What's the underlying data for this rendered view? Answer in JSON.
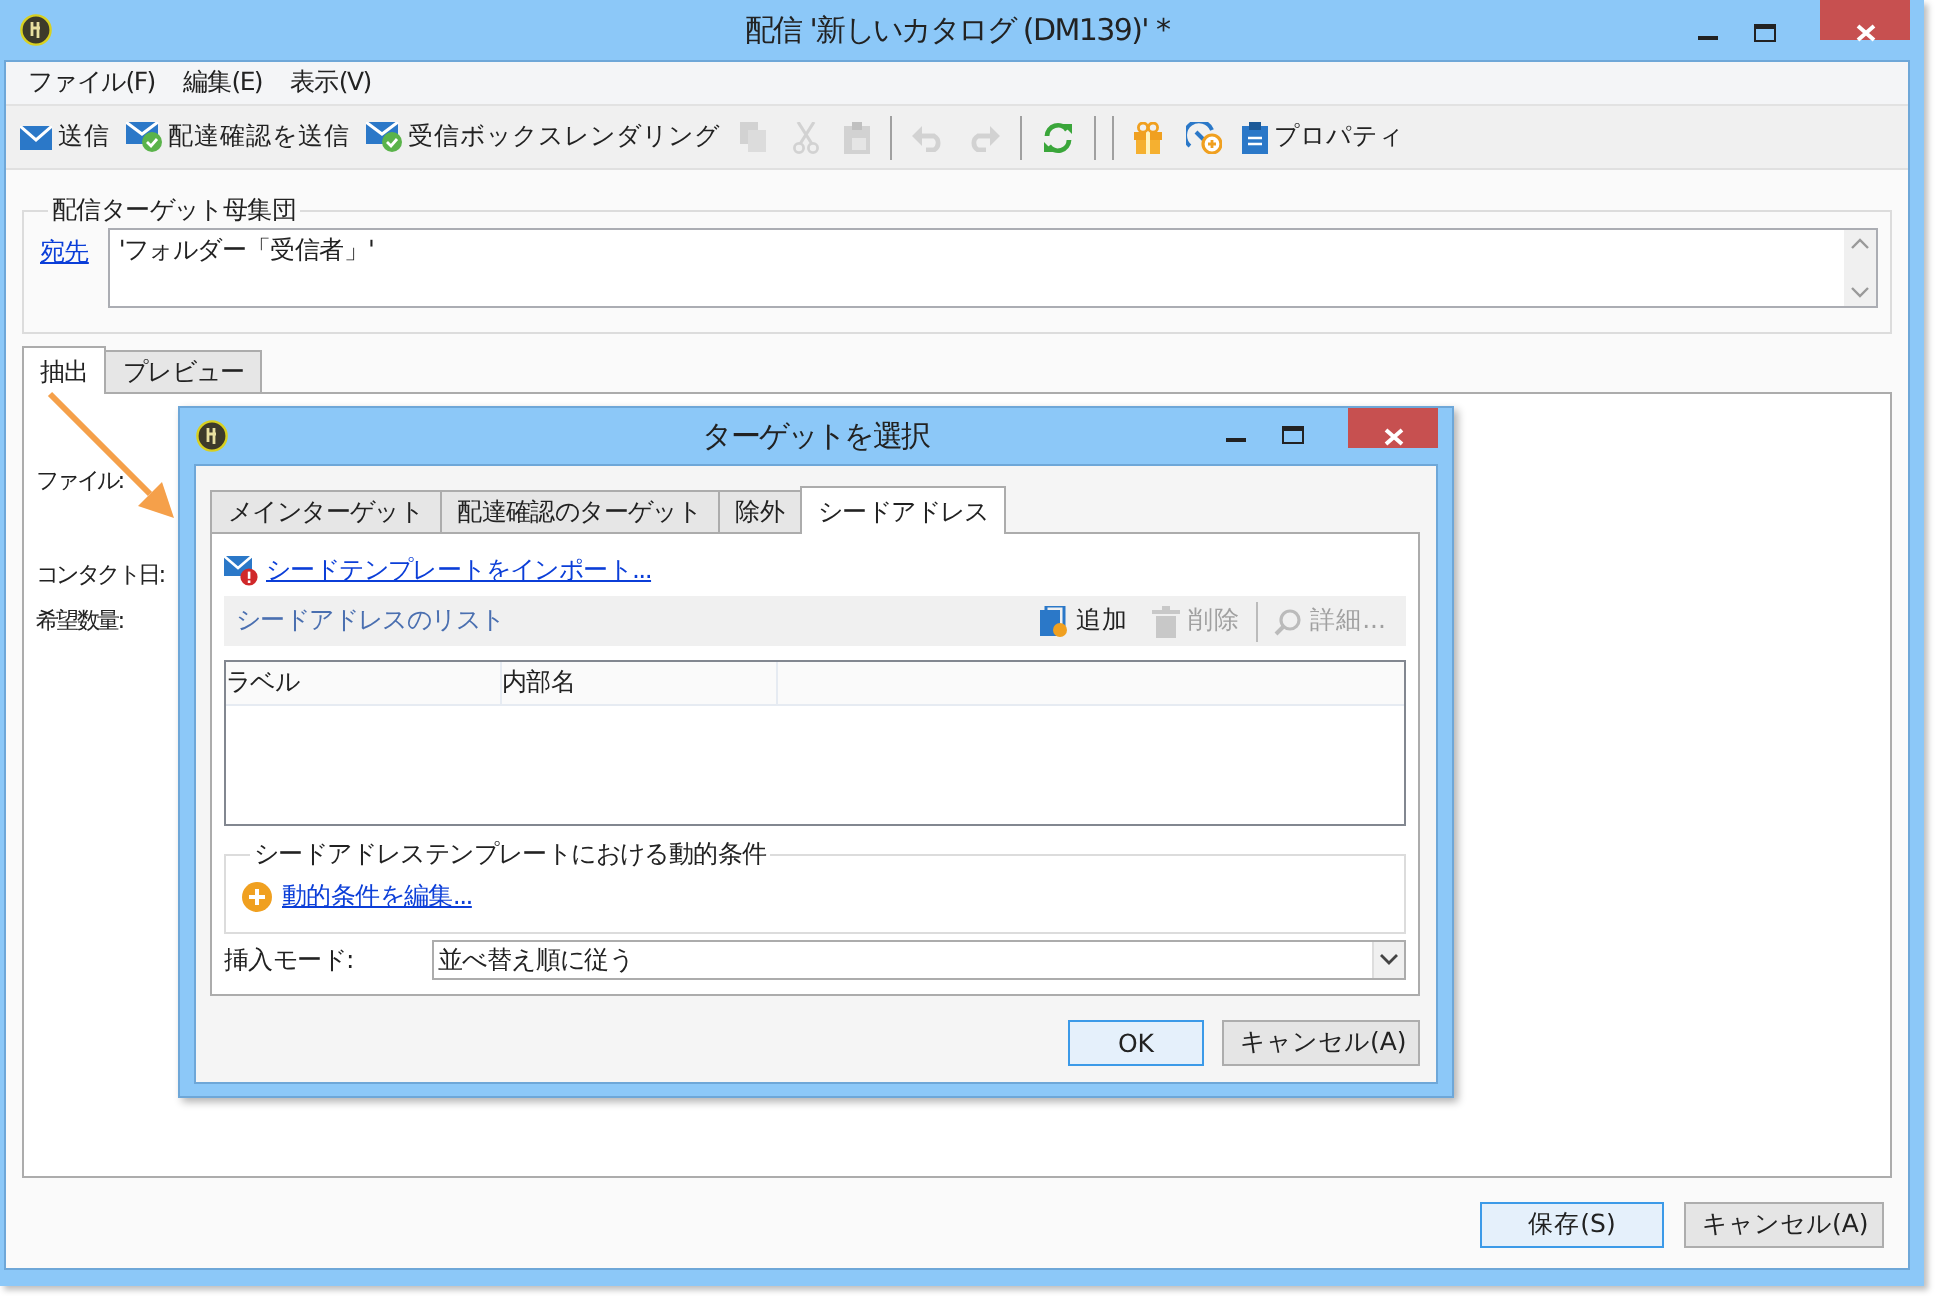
{
  "window": {
    "title": "配信 '新しいカタログ (DM139)' *"
  },
  "menu": [
    "ファイル(F)",
    "編集(E)",
    "表示(V)"
  ],
  "toolbar": [
    {
      "kind": "labeled",
      "label": "送信",
      "disabled": false
    },
    {
      "kind": "labeled",
      "label": "配達確認を送信",
      "disabled": false
    },
    {
      "kind": "labeled",
      "label": "受信ボックスレンダリング",
      "disabled": false
    },
    {
      "kind": "icon",
      "disabled": true
    },
    {
      "kind": "icon",
      "disabled": true
    },
    {
      "kind": "icon",
      "disabled": true
    },
    {
      "kind": "separator"
    },
    {
      "kind": "icon",
      "disabled": true
    },
    {
      "kind": "icon",
      "disabled": true
    },
    {
      "kind": "separator"
    },
    {
      "kind": "icon",
      "disabled": false
    },
    {
      "kind": "separator"
    },
    {
      "kind": "separator"
    },
    {
      "kind": "icon",
      "disabled": false
    },
    {
      "kind": "icon",
      "disabled": false
    },
    {
      "kind": "labeled",
      "label": "プロパティ",
      "disabled": false
    }
  ],
  "population": {
    "legend": "配信ターゲット母集団",
    "link": "宛先",
    "value": "'フォルダー「受信者」'"
  },
  "main_tabs": [
    {
      "label": "抽出",
      "selected": true
    },
    {
      "label": "プレビュー",
      "selected": false
    }
  ],
  "fields": [
    "ファイル:",
    "コンタクト日:",
    "希望数量:"
  ],
  "buttons": [
    {
      "label": "保存(S)",
      "default": true
    },
    {
      "label": "キャンセル(A)",
      "default": false
    }
  ],
  "dialog": {
    "title": "ターゲットを選択",
    "tabs": [
      {
        "label": "メインターゲット",
        "selected": false
      },
      {
        "label": "配達確認のターゲット",
        "selected": false
      },
      {
        "label": "除外",
        "selected": false
      },
      {
        "label": "シードアドレス",
        "selected": true
      }
    ],
    "import_link": "シードテンプレートをインポート...",
    "list": {
      "title": "シードアドレスのリスト",
      "actions": [
        {
          "label": "追加",
          "disabled": false
        },
        {
          "label": "削除",
          "disabled": true
        },
        {
          "label": "詳細...",
          "disabled": true
        }
      ],
      "columns": [
        "ラベル",
        "内部名"
      ]
    },
    "dynamic": {
      "legend": "シードアドレステンプレートにおける動的条件",
      "link": "動的条件を編集..."
    },
    "insert_mode": {
      "label": "挿入モード:",
      "value": "並べ替え順に従う"
    },
    "buttons": [
      {
        "label": "OK",
        "default": true
      },
      {
        "label": "キャンセル(A)",
        "default": false
      }
    ]
  }
}
